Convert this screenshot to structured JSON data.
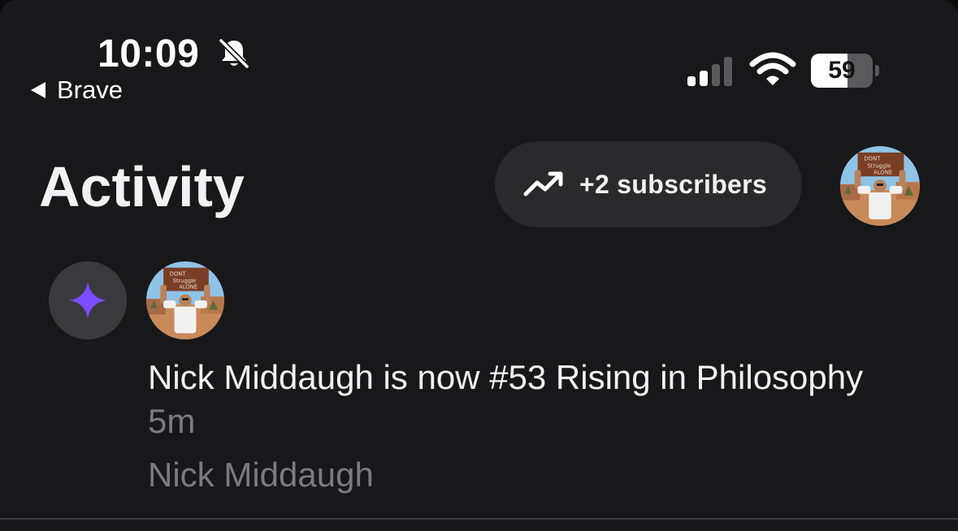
{
  "status_bar": {
    "time": "10:09",
    "back_app": "Brave",
    "battery_percent": "59",
    "battery_level": 0.59,
    "signal_bars_active": 2,
    "signal_bars_total": 4,
    "icons": [
      "bell-slash-icon",
      "signal-icon",
      "wifi-icon",
      "battery-icon"
    ]
  },
  "header": {
    "title": "Activity",
    "subscribers_label": "+2 subscribers",
    "subscribers_icon": "trending-up-icon"
  },
  "activity": {
    "items": [
      {
        "badge_icon": "sparkle-icon",
        "badge_color": "#7c4dff",
        "text": "Nick Middaugh is now #53 Rising in Philosophy",
        "time": "5m",
        "author": "Nick Middaugh",
        "avatar_sign_text": [
          "DONT",
          "Struggle",
          "ALONE"
        ]
      }
    ]
  },
  "colors": {
    "background": "#18181a",
    "pill": "#2a2a2d",
    "muted_text": "#7b7b80",
    "accent": "#7c4dff"
  }
}
